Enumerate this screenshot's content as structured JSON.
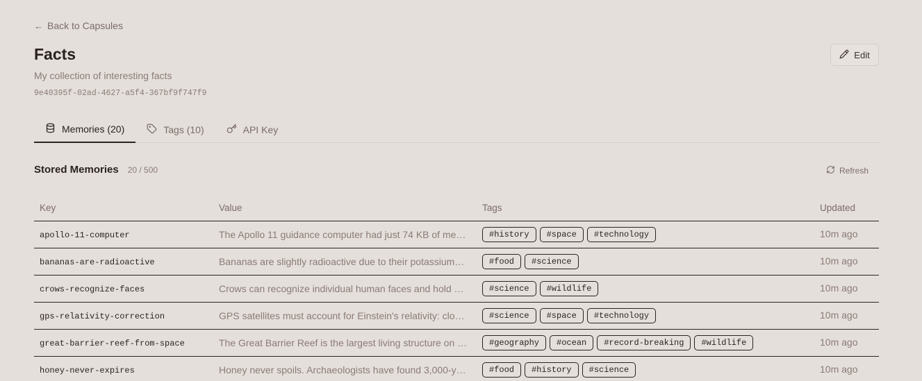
{
  "nav": {
    "back_label": "Back to Capsules"
  },
  "capsule": {
    "title": "Facts",
    "description": "My collection of interesting facts",
    "id": "9e40395f-02ad-4627-a5f4-367bf9f747f9",
    "edit_label": "Edit"
  },
  "tabs": [
    {
      "label": "Memories (20)",
      "icon": "database-icon",
      "active": true
    },
    {
      "label": "Tags (10)",
      "icon": "tag-icon",
      "active": false
    },
    {
      "label": "API Key",
      "icon": "key-icon",
      "active": false
    }
  ],
  "memories": {
    "title": "Stored Memories",
    "count": "20 / 500",
    "refresh_label": "Refresh",
    "columns": {
      "key": "Key",
      "value": "Value",
      "tags": "Tags",
      "updated": "Updated"
    },
    "rows": [
      {
        "key": "apollo-11-computer",
        "value": "The Apollo 11 guidance computer had just 74 KB of me…",
        "tags": [
          "#history",
          "#space",
          "#technology"
        ],
        "updated": "10m ago"
      },
      {
        "key": "bananas-are-radioactive",
        "value": "Bananas are slightly radioactive due to their potassium…",
        "tags": [
          "#food",
          "#science"
        ],
        "updated": "10m ago"
      },
      {
        "key": "crows-recognize-faces",
        "value": "Crows can recognize individual human faces and hold …",
        "tags": [
          "#science",
          "#wildlife"
        ],
        "updated": "10m ago"
      },
      {
        "key": "gps-relativity-correction",
        "value": "GPS satellites must account for Einstein's relativity: clo…",
        "tags": [
          "#science",
          "#space",
          "#technology"
        ],
        "updated": "10m ago"
      },
      {
        "key": "great-barrier-reef-from-space",
        "value": "The Great Barrier Reef is the largest living structure on …",
        "tags": [
          "#geography",
          "#ocean",
          "#record-breaking",
          "#wildlife"
        ],
        "updated": "10m ago"
      },
      {
        "key": "honey-never-expires",
        "value": "Honey never spoils. Archaeologists have found 3,000-y…",
        "tags": [
          "#food",
          "#history",
          "#science"
        ],
        "updated": "10m ago"
      }
    ]
  }
}
